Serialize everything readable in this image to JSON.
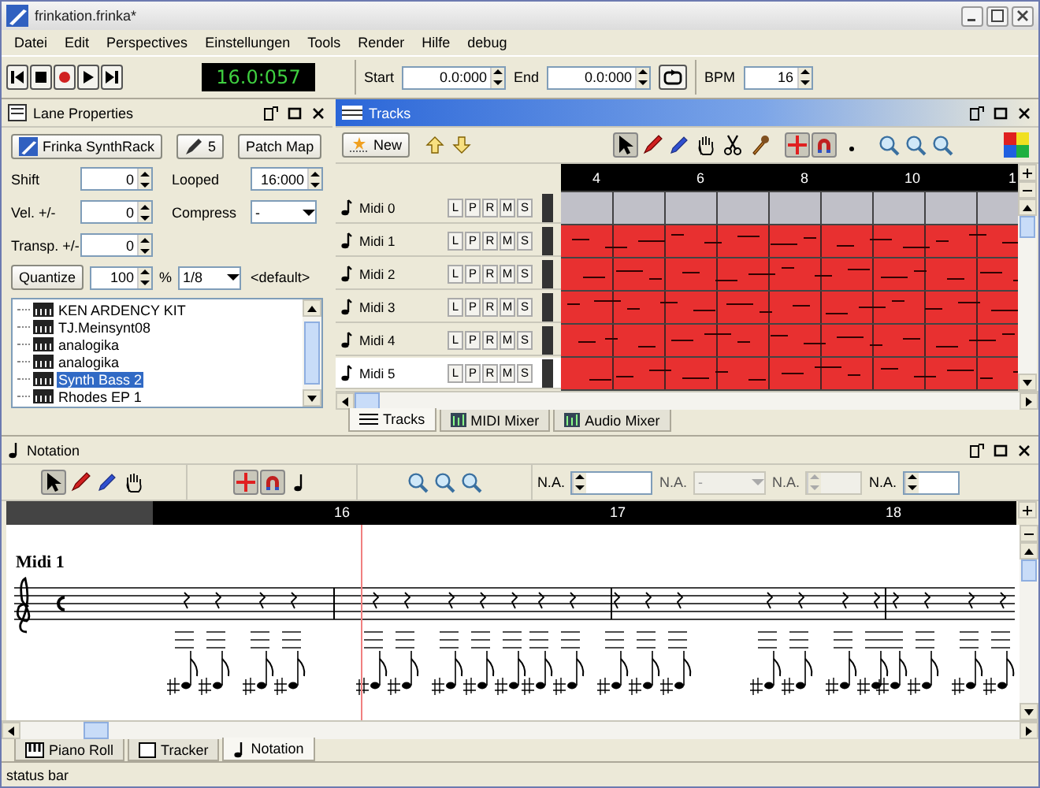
{
  "window": {
    "title": "frinkation.frinka*"
  },
  "menu": [
    "Datei",
    "Edit",
    "Perspectives",
    "Einstellungen",
    "Tools",
    "Render",
    "Hilfe",
    "debug"
  ],
  "transport": {
    "time": "16.0:057",
    "start_label": "Start",
    "start_value": "0.0:000",
    "end_label": "End",
    "end_value": "0.0:000",
    "bpm_label": "BPM",
    "bpm_value": "16"
  },
  "lane_properties": {
    "title": "Lane Properties",
    "synth_button": "Frinka SynthRack",
    "channel_button": "5",
    "patch_map_button": "Patch Map",
    "shift_label": "Shift",
    "shift_value": "0",
    "looped_label": "Looped",
    "looped_value": "16:000",
    "velocity_label": "Vel. +/-",
    "velocity_value": "0",
    "compress_label": "Compress",
    "compress_value": "-",
    "transpose_label": "Transp. +/-",
    "transpose_value": "0",
    "quantize_button": "Quantize",
    "quantize_value": "100",
    "percent": "%",
    "quantize_grid": "1/8",
    "default_label": "<default>",
    "patches": [
      {
        "label": "KEN ARDENCY KIT",
        "selected": false
      },
      {
        "label": "TJ.Meinsynt08",
        "selected": false
      },
      {
        "label": "analogika",
        "selected": false
      },
      {
        "label": "analogika",
        "selected": false
      },
      {
        "label": "Synth Bass 2",
        "selected": true
      },
      {
        "label": "Rhodes EP 1",
        "selected": false
      }
    ]
  },
  "tracks_panel": {
    "title": "Tracks",
    "new_button": "New",
    "tools": [
      {
        "kind": "pointer",
        "selected": true
      },
      {
        "kind": "pencil",
        "selected": false
      },
      {
        "kind": "marker",
        "selected": false
      },
      {
        "kind": "hand",
        "selected": false
      },
      {
        "kind": "scissors",
        "selected": false
      },
      {
        "kind": "dropper",
        "selected": false
      }
    ],
    "snap": [
      {
        "kind": "cross",
        "selected": true
      },
      {
        "kind": "magnet",
        "selected": true
      },
      {
        "kind": "dot",
        "selected": false
      }
    ],
    "ruler": [
      "4",
      "6",
      "8",
      "10",
      "1"
    ],
    "tracks": [
      {
        "name": "Midi 0",
        "selected": false,
        "color": "#c0c0c8",
        "buttons": [
          "L",
          "P",
          "R",
          "M",
          "S"
        ]
      },
      {
        "name": "Midi 1",
        "selected": false,
        "color": "#e83030",
        "buttons": [
          "L",
          "P",
          "R",
          "M",
          "S"
        ]
      },
      {
        "name": "Midi 2",
        "selected": false,
        "color": "#e83030",
        "buttons": [
          "L",
          "P",
          "R",
          "M",
          "S"
        ]
      },
      {
        "name": "Midi 3",
        "selected": false,
        "color": "#e83030",
        "buttons": [
          "L",
          "P",
          "R",
          "M",
          "S"
        ]
      },
      {
        "name": "Midi 4",
        "selected": false,
        "color": "#e83030",
        "buttons": [
          "L",
          "P",
          "R",
          "M",
          "S"
        ]
      },
      {
        "name": "Midi 5",
        "selected": true,
        "color": "#e83030",
        "buttons": [
          "L",
          "P",
          "R",
          "M",
          "S"
        ]
      }
    ],
    "tabs": [
      {
        "label": "Tracks",
        "kind": "tracks",
        "selected": true
      },
      {
        "label": "MIDI Mixer",
        "kind": "mixer",
        "selected": false
      },
      {
        "label": "Audio Mixer",
        "kind": "mixer",
        "selected": false
      }
    ]
  },
  "notation": {
    "title": "Notation",
    "tools": [
      {
        "kind": "pointer",
        "selected": true
      },
      {
        "kind": "pencil",
        "selected": false
      },
      {
        "kind": "marker",
        "selected": false
      },
      {
        "kind": "hand",
        "selected": false
      }
    ],
    "snap": [
      {
        "kind": "cross",
        "selected": true
      },
      {
        "kind": "magnet",
        "selected": true
      },
      {
        "kind": "note",
        "selected": false
      }
    ],
    "fields": [
      {
        "label": "N.A.",
        "kind": "spinner",
        "disabled": false
      },
      {
        "label": "N.A.",
        "kind": "dropdown",
        "value": "-",
        "disabled": true
      },
      {
        "label": "N.A.",
        "kind": "spinner",
        "disabled": true
      },
      {
        "label": "N.A.",
        "kind": "spinner",
        "disabled": false
      }
    ],
    "ruler": [
      "16",
      "17",
      "18"
    ],
    "staff_label": "Midi 1",
    "tabs": [
      {
        "label": "Piano Roll",
        "kind": "piano",
        "selected": false
      },
      {
        "label": "Tracker",
        "kind": "tracker",
        "selected": false
      },
      {
        "label": "Notation",
        "kind": "note",
        "selected": true
      }
    ]
  },
  "status_bar": "status bar"
}
